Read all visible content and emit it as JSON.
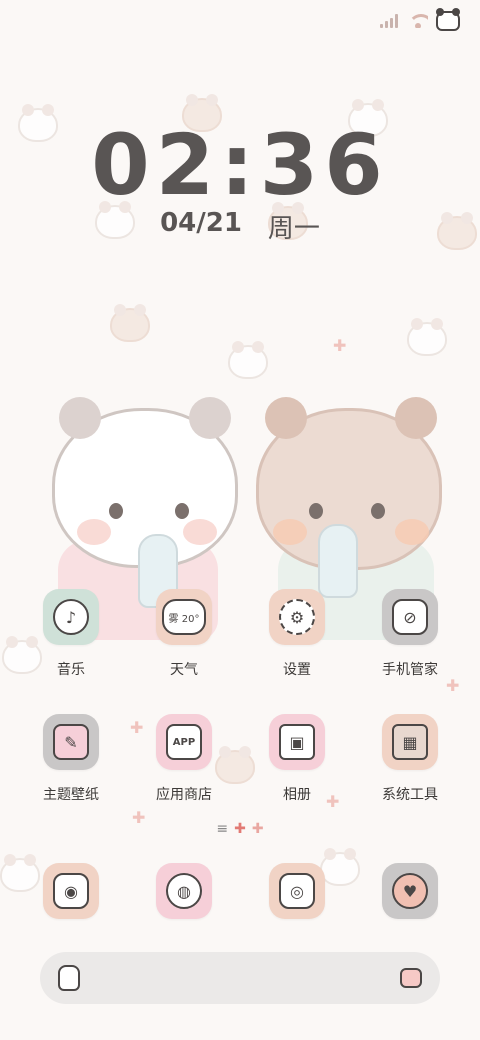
{
  "status_bar": {
    "icons": [
      "signal-icon",
      "wifi-icon",
      "bear-battery-icon"
    ]
  },
  "lock_clock": {
    "time": "02:36",
    "date": "04/21",
    "weekday": "周一"
  },
  "apps_row1": [
    {
      "label": "音乐",
      "icon": "music-icon",
      "bg": "#cfe1d8"
    },
    {
      "label": "天气",
      "icon": "weather-icon",
      "badge": "雾 20°",
      "bg": "#f1d3c5"
    },
    {
      "label": "设置",
      "icon": "gear-icon",
      "bg": "#f1d3c5"
    },
    {
      "label": "手机管家",
      "icon": "shield-icon",
      "bg": "#c9c7c7"
    }
  ],
  "apps_row2": [
    {
      "label": "主题壁纸",
      "icon": "brush-icon",
      "bg": "#c9c7c7"
    },
    {
      "label": "应用商店",
      "icon": "store-icon",
      "badge": "APP",
      "bg": "#f6cfd8"
    },
    {
      "label": "相册",
      "icon": "gallery-icon",
      "bg": "#f6cfd8"
    },
    {
      "label": "系统工具",
      "icon": "folder-icon",
      "bg": "#f1d3c5"
    }
  ],
  "page_indicator": {
    "lines": "≡",
    "marks": [
      "✚",
      "✚"
    ]
  },
  "dock": [
    {
      "icon": "camera-icon",
      "bg": "#f1d3c5"
    },
    {
      "icon": "browser-icon",
      "bg": "#f6cfd8"
    },
    {
      "icon": "phone-camera-icon",
      "bg": "#f1d3c5"
    },
    {
      "icon": "message-icon",
      "bg": "#c9c7c7"
    }
  ],
  "search_bar": {
    "left_icon": "bottle-icon",
    "right_icon": "mic-icon"
  },
  "colors": {
    "background": "#fbf8f6",
    "clock_text": "#595554",
    "accent_pink": "#e27a74"
  }
}
